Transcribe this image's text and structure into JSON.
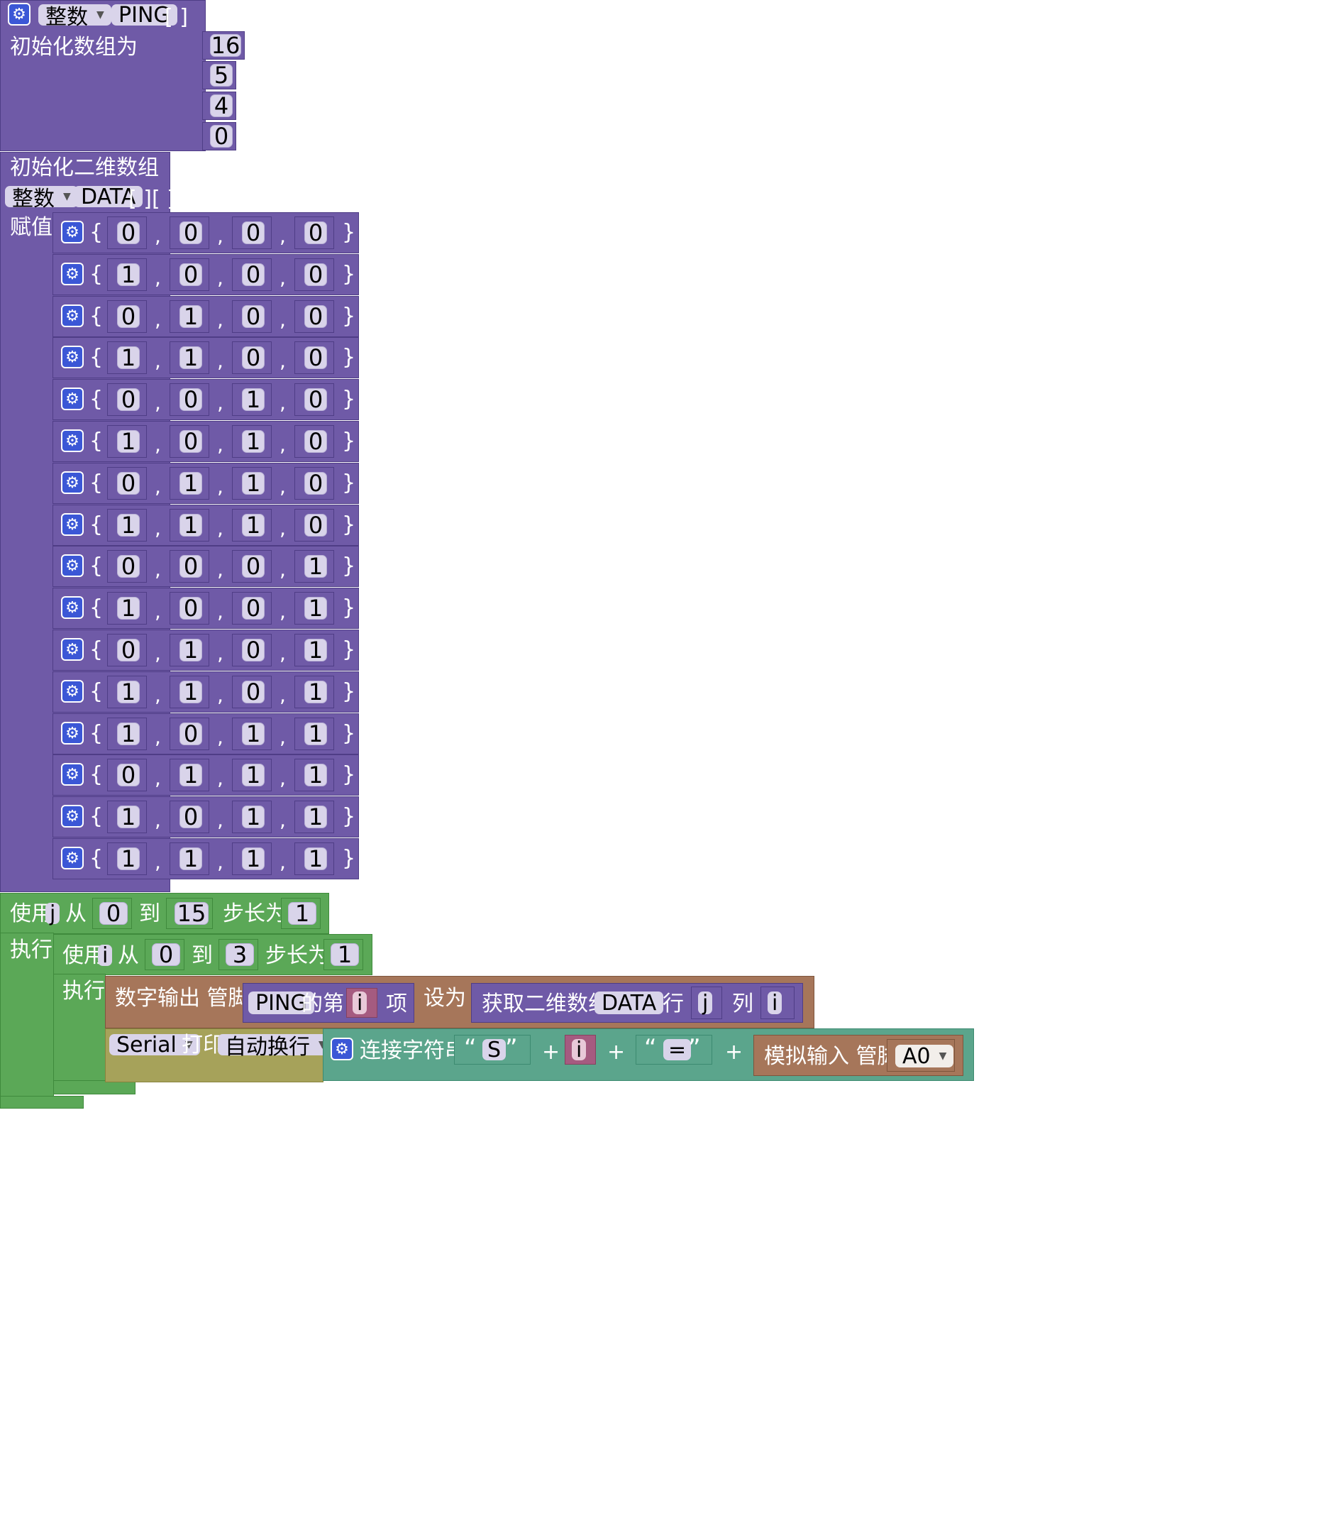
{
  "ping_block": {
    "type_label": "整数",
    "array_name": "PING",
    "array_brackets": "[ ]",
    "init_label": "初始化数组为",
    "values": [
      "16",
      "5",
      "4",
      "0"
    ]
  },
  "data_block": {
    "title": "初始化二维数组",
    "type_label": "整数",
    "array_name": "DATA",
    "array_brackets": "[ ][ ]",
    "assign_label": "赋值",
    "open_brace": "{",
    "close_brace": "}",
    "comma": ",",
    "rows": [
      [
        "0",
        "0",
        "0",
        "0"
      ],
      [
        "1",
        "0",
        "0",
        "0"
      ],
      [
        "0",
        "1",
        "0",
        "0"
      ],
      [
        "1",
        "1",
        "0",
        "0"
      ],
      [
        "0",
        "0",
        "1",
        "0"
      ],
      [
        "1",
        "0",
        "1",
        "0"
      ],
      [
        "0",
        "1",
        "1",
        "0"
      ],
      [
        "1",
        "1",
        "1",
        "0"
      ],
      [
        "0",
        "0",
        "0",
        "1"
      ],
      [
        "1",
        "0",
        "0",
        "1"
      ],
      [
        "0",
        "1",
        "0",
        "1"
      ],
      [
        "1",
        "1",
        "0",
        "1"
      ],
      [
        "1",
        "0",
        "1",
        "1"
      ],
      [
        "0",
        "1",
        "1",
        "1"
      ],
      [
        "1",
        "0",
        "1",
        "1"
      ],
      [
        "1",
        "1",
        "1",
        "1"
      ]
    ]
  },
  "outer_loop": {
    "use_label": "使用",
    "var": "j",
    "from_label": "从",
    "from": "0",
    "to_label": "到",
    "to": "15",
    "step_label": "步长为",
    "step": "1",
    "do_label": "执行"
  },
  "inner_loop": {
    "use_label": "使用",
    "var": "i",
    "from_label": "从",
    "from": "0",
    "to_label": "到",
    "to": "3",
    "step_label": "步长为",
    "step": "1",
    "do_label": "执行"
  },
  "digital_write": {
    "label": "数字输出 管脚 #",
    "array_name": "PING",
    "index_of_label": "的第",
    "index_var": "i",
    "item_label": "项",
    "set_label": "设为",
    "get2d_label": "获取二维数组",
    "get2d_array": "DATA",
    "row_label": "行",
    "row_var": "j",
    "col_label": "列",
    "col_var": "i"
  },
  "serial_print": {
    "port": "Serial",
    "print_label": "打印",
    "mode": "自动换行",
    "concat_label": "连接字符串",
    "open_quote": "“",
    "close_quote": "”",
    "str1": "S",
    "plus": "+",
    "var_i": "i",
    "str2": "=",
    "analog_label": "模拟输入 管脚 #",
    "analog_pin": "A0"
  },
  "colors": {
    "array_block": "#6f5aa7",
    "loop_block": "#5ba857",
    "io_block": "#a6765a",
    "serial_block": "#a6a25a",
    "text_block": "#5ba58c",
    "variable_block": "#a55b80",
    "gear_icon": "#3b57d6"
  }
}
